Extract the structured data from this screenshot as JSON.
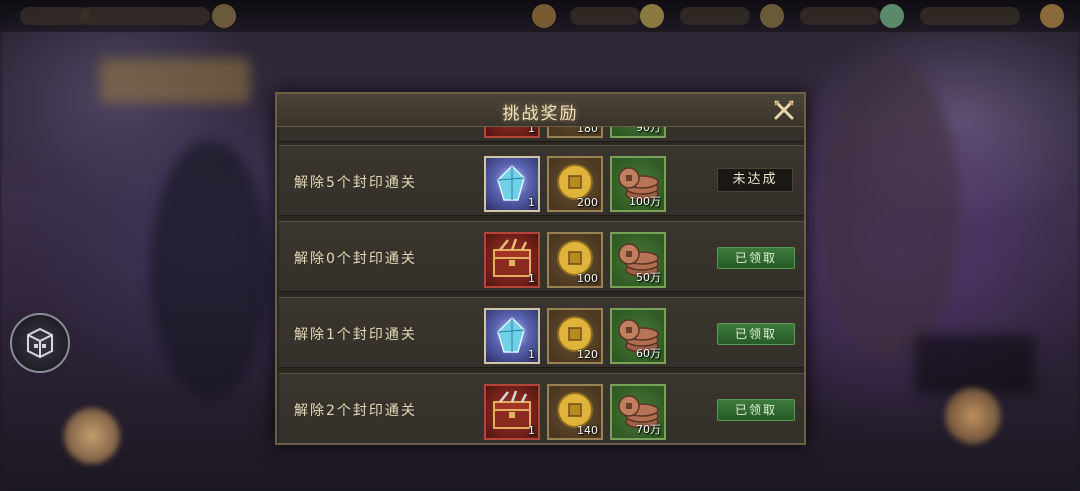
{
  "dialog": {
    "title": "挑战奖励"
  },
  "partial_row": {
    "qtys": [
      "1",
      "180",
      "90万"
    ]
  },
  "rows": [
    {
      "label": "解除5个封印通关",
      "first_item": "gem",
      "first_qty": "1",
      "gold_qty": "200",
      "copper_qty": "100万",
      "status": "未达成",
      "status_type": "pending"
    },
    {
      "label": "解除0个封印通关",
      "first_item": "chest",
      "first_qty": "1",
      "gold_qty": "100",
      "copper_qty": "50万",
      "status": "已领取",
      "status_type": "claimed"
    },
    {
      "label": "解除1个封印通关",
      "first_item": "gem",
      "first_qty": "1",
      "gold_qty": "120",
      "copper_qty": "60万",
      "status": "已领取",
      "status_type": "claimed"
    },
    {
      "label": "解除2个封印通关",
      "first_item": "chest",
      "first_qty": "1",
      "gold_qty": "140",
      "copper_qty": "70万",
      "status": "已领取",
      "status_type": "claimed"
    }
  ],
  "icons": {
    "close": "close-x-icon",
    "side": "cube-menu-icon",
    "gem": "blue-crystal-icon",
    "chest": "treasure-chest-icon",
    "gold": "gold-coin-icon",
    "copper": "copper-coins-icon"
  },
  "colors": {
    "title": "#f0e3c0",
    "claimed_button": "#2f6a2e",
    "pending_badge": "#1a1815"
  }
}
